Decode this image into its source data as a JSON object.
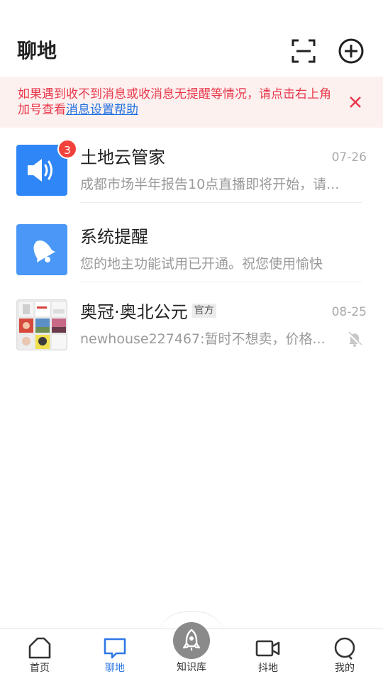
{
  "header": {
    "title": "聊地",
    "scan_icon": "scan-icon",
    "add_icon": "plus-circle-icon"
  },
  "notice": {
    "text": "如果遇到收不到消息或收消息无提醒等情况，请点击右上角加号查看",
    "link": "消息设置帮助",
    "close_icon": "close-icon",
    "color": "#e8374a",
    "background": "#fdf1f0"
  },
  "chats": [
    {
      "name": "土地云管家",
      "time": "07-26",
      "preview": "成都市场半年报告10点直播即将开始，请...",
      "badge": "3",
      "avatar_icon": "speaker-icon",
      "avatar_color": "#2f86f6"
    },
    {
      "name": "系统提醒",
      "time": "",
      "preview": "您的地主功能试用已开通。祝您使用愉快",
      "avatar_icon": "bell-icon",
      "avatar_color": "#4a97f7"
    },
    {
      "name": "奥冠·奥北公元",
      "tag": "官方",
      "time": "08-25",
      "preview": "newhouse227467:暂时不想卖，价格...",
      "avatar_icon": "group-avatar-icon",
      "muted_icon": "mute-bell-icon"
    }
  ],
  "bottom_nav": {
    "items": [
      {
        "label": "首页",
        "icon": "home-icon",
        "active": false
      },
      {
        "label": "聊地",
        "icon": "chat-icon",
        "active": true
      },
      {
        "label": "知识库",
        "icon": "rocket-icon",
        "active": false
      },
      {
        "label": "抖地",
        "icon": "video-icon",
        "active": false
      },
      {
        "label": "我的",
        "icon": "profile-circle-icon",
        "active": false
      }
    ],
    "active_color": "#2e78e6"
  }
}
